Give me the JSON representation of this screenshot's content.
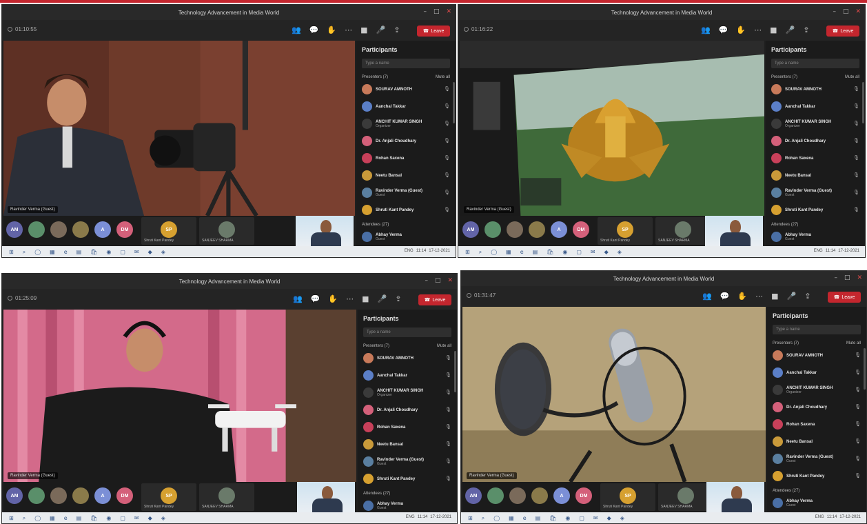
{
  "meeting_title": "Technology Advancement in Media World",
  "panels": [
    {
      "timer": "01:10:55",
      "speaker": "Ravinder Verma (Guest)"
    },
    {
      "timer": "01:16:22",
      "speaker": "Ravinder Verma (Guest)"
    },
    {
      "timer": "01:25:09",
      "speaker": "Ravinder Verma (Guest)"
    },
    {
      "timer": "01:31:47",
      "speaker": "Ravinder Verma (Guest)"
    }
  ],
  "toolbar": {
    "leave_label": "Leave"
  },
  "participants_panel": {
    "title": "Participants",
    "search_placeholder": "Type a name",
    "presenters_label": "Presenters (7)",
    "mute_all": "Mute all",
    "attendees_label": "Attendees (27)"
  },
  "participants": [
    {
      "name": "SOURAV AMNOTH",
      "sub": "",
      "color": "#c87a5a"
    },
    {
      "name": "Aanchal Takkar",
      "sub": "",
      "color": "#5b7fc7"
    },
    {
      "name": "ANCHIT KUMAR SINGH",
      "sub": "Organizer",
      "color": "#3a3a3a"
    },
    {
      "name": "Dr. Anjali Choudhary",
      "sub": "",
      "color": "#d4607a"
    },
    {
      "name": "Rohan Saxena",
      "sub": "",
      "color": "#c8405a"
    },
    {
      "name": "Neetu Bansal",
      "sub": "",
      "color": "#c99a3a"
    },
    {
      "name": "Ravinder Verma (Guest)",
      "sub": "Guest",
      "color": "#5a7fa0"
    },
    {
      "name": "Shruti Kant Pandey",
      "sub": "",
      "color": "#d6a030"
    }
  ],
  "attendee_first": {
    "name": "Abhay Verma",
    "sub": "Guest",
    "color": "#4a6fa5"
  },
  "rail": {
    "avatars": [
      {
        "initials": "AM",
        "color": "#6264a7"
      },
      {
        "initials": "",
        "color": "#5a8f6a"
      },
      {
        "initials": "",
        "color": "#7a6a5a"
      },
      {
        "initials": "",
        "color": "#8a7a4a"
      },
      {
        "initials": "A",
        "color": "#7b8fd6"
      },
      {
        "initials": "DM",
        "color": "#d4607a"
      }
    ],
    "tiles": [
      {
        "initials": "SP",
        "label": "Shruti Kant Pandey",
        "color": "#d6a030"
      },
      {
        "initials": "",
        "label": "SANJEEV SHARMA",
        "color": "#6a7a6a"
      }
    ]
  },
  "taskbar": {
    "time": "11:14",
    "date": "17-12-2021",
    "lang": "ENG"
  },
  "icons": [
    "timer-icon",
    "people-icon",
    "chat-icon",
    "raise-hand-icon",
    "more-icon",
    "camera-icon",
    "mic-icon",
    "share-icon",
    "phone-icon",
    "mic-icon",
    "windows-icon"
  ]
}
